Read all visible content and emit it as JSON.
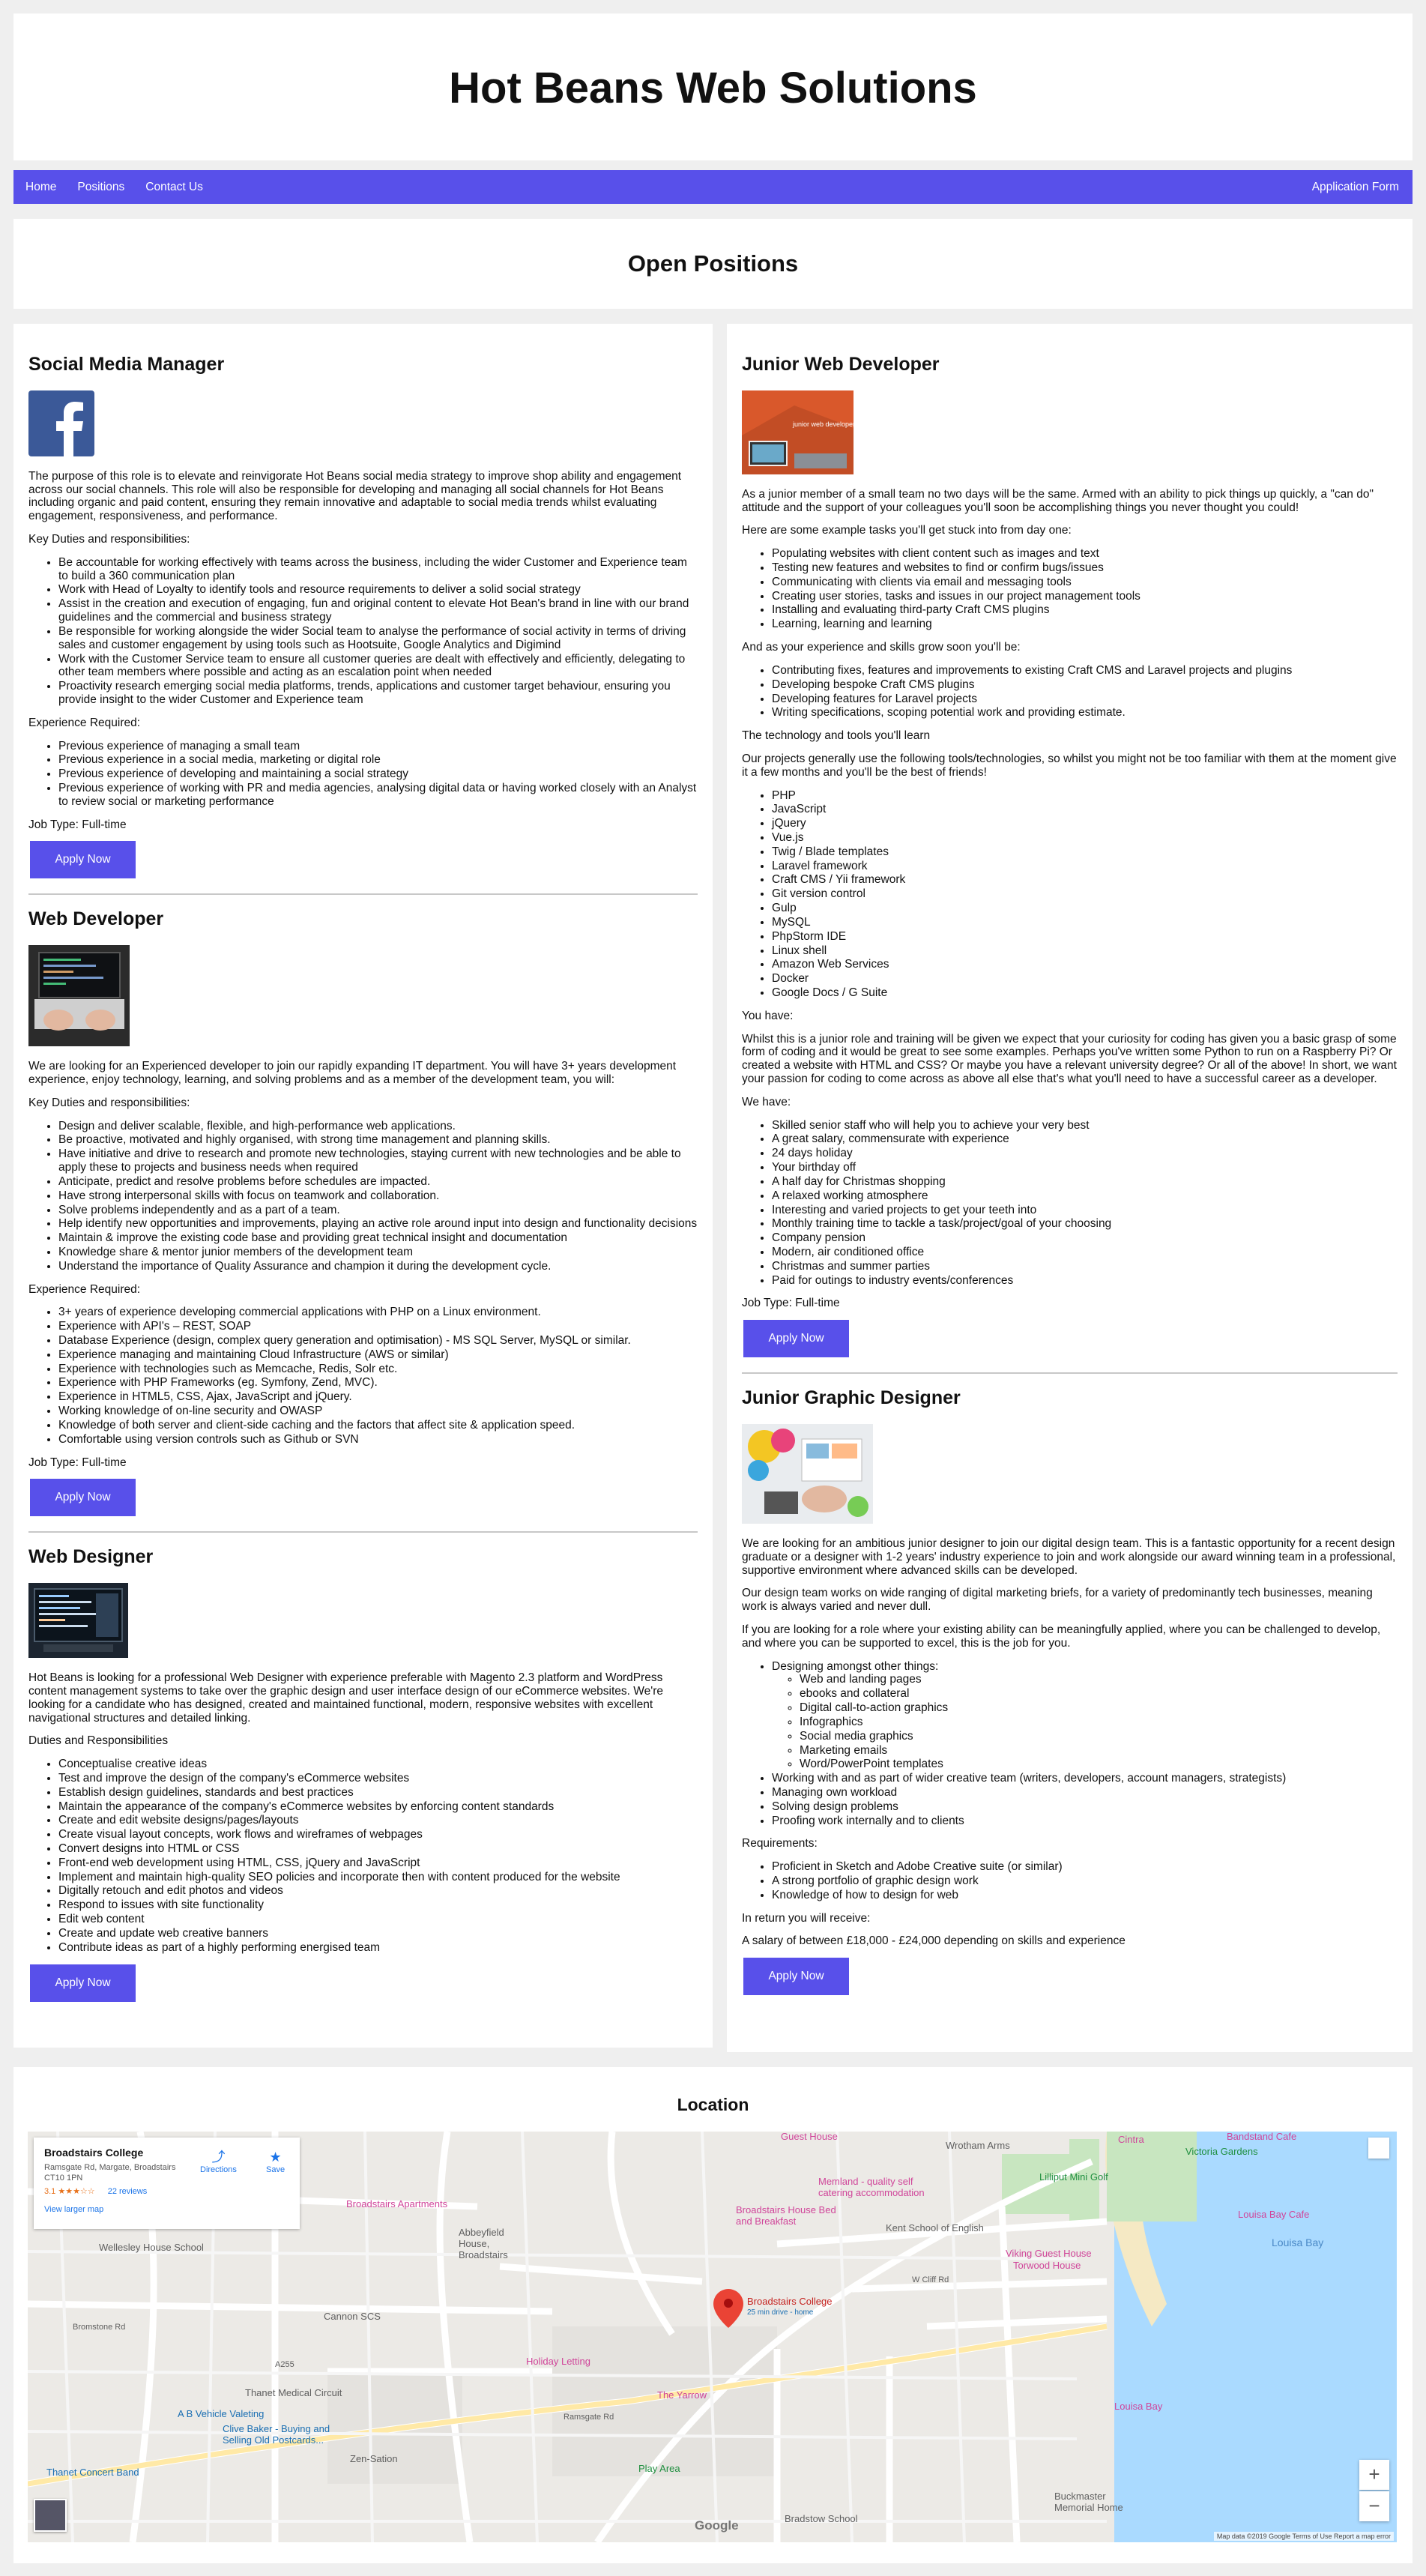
{
  "site": {
    "title": "Hot Beans Web Solutions"
  },
  "nav": {
    "home": "Home",
    "positions": "Positions",
    "contact": "Contact Us",
    "application": "Application Form"
  },
  "page": {
    "heading": "Open Positions"
  },
  "colors": {
    "accent": "#5850ea",
    "background": "#efefef"
  },
  "jobs": {
    "social": {
      "title": "Social Media Manager",
      "intro": "The purpose of this role is to elevate and reinvigorate Hot Beans social media strategy to improve shop ability and engagement across our social channels. This role will also be responsible for developing and managing all social channels for Hot Beans including organic and paid content, ensuring they remain innovative and adaptable to social media trends whilst evaluating engagement, responsiveness, and performance.",
      "duties_heading": "Key Duties and responsibilities:",
      "duties": [
        "Be accountable for working effectively with teams across the business, including the wider Customer and Experience team to build a 360 communication plan",
        "Work with Head of Loyalty to identify tools and resource requirements to deliver a solid social strategy",
        "Assist in the creation and execution of engaging, fun and original content to elevate Hot Bean's brand in line with our brand guidelines and the commercial and business strategy",
        "Be responsible for working alongside the wider Social team to analyse the performance of social activity in terms of driving sales and customer engagement by using tools such as Hootsuite, Google Analytics and Digimind",
        "Work with the Customer Service team to ensure all customer queries are dealt with effectively and efficiently, delegating to other team members where possible and acting as an escalation point when needed",
        "Proactivity research emerging social media platforms, trends, applications and customer target behaviour, ensuring you provide insight to the wider Customer and Experience team"
      ],
      "exp_heading": "Experience Required:",
      "experience": [
        "Previous experience of managing a small team",
        "Previous experience in a social media, marketing or digital role",
        "Previous experience of developing and maintaining a social strategy",
        "Previous experience of working with PR and media agencies, analysing digital data or having worked closely with an Analyst to review social or marketing performance"
      ],
      "job_type": "Job Type: Full-time",
      "apply": "Apply Now"
    },
    "webdev": {
      "title": "Web Developer",
      "intro": "We are looking for an Experienced developer to join our rapidly expanding IT department. You will have 3+ years development experience, enjoy technology, learning, and solving problems and as a member of the development team, you will:",
      "duties_heading": "Key Duties and responsibilities:",
      "duties": [
        "Design and deliver scalable, flexible, and high-performance web applications.",
        "Be proactive, motivated and highly organised, with strong time management and planning skills.",
        "Have initiative and drive to research and promote new technologies, staying current with new technologies and be able to apply these to projects and business needs when required",
        "Anticipate, predict and resolve problems before schedules are impacted.",
        "Have strong interpersonal skills with focus on teamwork and collaboration.",
        "Solve problems independently and as a part of a team.",
        "Help identify new opportunities and improvements, playing an active role around input into design and functionality decisions",
        "Maintain & improve the existing code base and providing great technical insight and documentation",
        "Knowledge share & mentor junior members of the development team",
        "Understand the importance of Quality Assurance and champion it during the development cycle."
      ],
      "exp_heading": "Experience Required:",
      "experience": [
        "3+ years of experience developing commercial applications with PHP on a Linux environment.",
        "Experience with API's – REST, SOAP",
        "Database Experience (design, complex query generation and optimisation) - MS SQL Server, MySQL or similar.",
        "Experience managing and maintaining Cloud Infrastructure (AWS or similar)",
        "Experience with technologies such as Memcache, Redis, Solr etc.",
        "Experience with PHP Frameworks (eg. Symfony, Zend, MVC).",
        "Experience in HTML5, CSS, Ajax, JavaScript and jQuery.",
        "Working knowledge of on-line security and OWASP",
        "Knowledge of both server and client-side caching and the factors that affect site & application speed.",
        "Comfortable using version controls such as Github or SVN"
      ],
      "job_type": "Job Type: Full-time",
      "apply": "Apply Now"
    },
    "webdesign": {
      "title": "Web Designer",
      "intro": "Hot Beans is looking for a professional Web Designer with experience preferable with Magento 2.3 platform and WordPress content management systems to take over the graphic design and user interface design of our eCommerce websites. We're looking for a candidate who has designed, created and maintained functional, modern, responsive websites with excellent navigational structures and detailed linking.",
      "duties_heading": "Duties and Responsibilities",
      "duties": [
        "Conceptualise creative ideas",
        "Test and improve the design of the company's eCommerce websites",
        "Establish design guidelines, standards and best practices",
        "Maintain the appearance of the company's eCommerce websites by enforcing content standards",
        "Create and edit website designs/pages/layouts",
        "Create visual layout concepts, work flows and wireframes of webpages",
        "Convert designs into HTML or CSS",
        "Front-end web development using HTML, CSS, jQuery and JavaScript",
        "Implement and maintain high-quality SEO policies and incorporate then with content produced for the website",
        "Digitally retouch and edit photos and videos",
        "Respond to issues with site functionality",
        "Edit web content",
        "Create and update web creative banners",
        "Contribute ideas as part of a highly performing energised team"
      ],
      "apply": "Apply Now"
    },
    "junior": {
      "title": "Junior Web Developer",
      "thumb_text": "junior web developer",
      "intro": "As a junior member of a small team no two days will be the same. Armed with an ability to pick things up quickly, a \"can do\" attitude and the support of your colleagues you'll soon be accomplishing things you never thought you could!",
      "tasks_heading": "Here are some example tasks you'll get stuck into from day one:",
      "tasks": [
        "Populating websites with client content such as images and text",
        "Testing new features and websites to find or confirm bugs/issues",
        "Communicating with clients via email and messaging tools",
        "Creating user stories, tasks and issues in our project management tools",
        "Installing and evaluating third-party Craft CMS plugins",
        "Learning, learning and learning"
      ],
      "grow_heading": "And as your experience and skills grow soon you'll be:",
      "grow": [
        "Contributing fixes, features and improvements to existing Craft CMS and Laravel projects and plugins",
        "Developing bespoke Craft CMS plugins",
        "Developing features for Laravel projects",
        "Writing specifications, scoping potential work and providing estimate."
      ],
      "tools_heading": "The technology and tools you'll learn",
      "tools_intro": "Our projects generally use the following tools/technologies, so whilst you might not be too familiar with them at the moment give it a few months and you'll be the best of friends!",
      "tools": [
        "PHP",
        "JavaScript",
        "jQuery",
        "Vue.js",
        "Twig / Blade templates",
        "Laravel framework",
        "Craft CMS / Yii framework",
        "Git version control",
        "Gulp",
        "MySQL",
        "PhpStorm IDE",
        "Linux shell",
        "Amazon Web Services",
        "Docker",
        "Google Docs / G Suite"
      ],
      "you_heading": "You have:",
      "you_text": "Whilst this is a junior role and training will be given we expect that your curiosity for coding has given you a basic grasp of some form of coding and it would be great to see some examples. Perhaps you've written some Python to run on a Raspberry Pi? Or created a website with HTML and CSS? Or maybe you have a relevant university degree? Or all of the above! In short, we want your passion for coding to come across as above all else that's what you'll need to have a successful career as a developer.",
      "we_heading": "We have:",
      "we": [
        "Skilled senior staff who will help you to achieve your very best",
        "A great salary, commensurate with experience",
        "24 days holiday",
        "Your birthday off",
        "A half day for Christmas shopping",
        "A relaxed working atmosphere",
        "Interesting and varied projects to get your teeth into",
        "Monthly training time to tackle a task/project/goal of your choosing",
        "Company pension",
        "Modern, air conditioned office",
        "Christmas and summer parties",
        "Paid for outings to industry events/conferences"
      ],
      "job_type": "Job Type: Full-time",
      "apply": "Apply Now"
    },
    "graphic": {
      "title": "Junior Graphic Designer",
      "p1": "We are looking for an ambitious junior designer to join our digital design team. This is a fantastic opportunity for a recent design graduate or a designer with 1-2 years' industry experience to join and work alongside our award winning team in a professional, supportive environment where advanced skills can be developed.",
      "p2": "Our design team works on wide ranging of digital marketing briefs, for a variety of predominantly tech businesses, meaning work is always varied and never dull.",
      "p3": "If you are looking for a role where your existing ability can be meaningfully applied, where you can be challenged to develop, and where you can be supported to excel, this is the job for you.",
      "designing": "Designing amongst other things:",
      "designing_items": [
        "Web and landing pages",
        "ebooks and collateral",
        "Digital call-to-action graphics",
        "Infographics",
        "Social media graphics",
        "Marketing emails",
        "Word/PowerPoint templates"
      ],
      "other": [
        "Working with and as part of wider creative team (writers, developers, account managers, strategists)",
        "Managing own workload",
        "Solving design problems",
        "Proofing work internally and to clients"
      ],
      "req_heading": "Requirements:",
      "requirements": [
        "Proficient in Sketch and Adobe Creative suite (or similar)",
        "A strong portfolio of graphic design work",
        "Knowledge of how to design for web"
      ],
      "return_heading": "In return you will receive:",
      "salary": "A salary of between £18,000 - £24,000 depending on skills and experience",
      "apply": "Apply Now"
    }
  },
  "location": {
    "heading": "Location",
    "card": {
      "name": "Broadstairs College",
      "address": "Ramsgate Rd, Margate, Broadstairs CT10 1PN",
      "rating": "3.1 ★★★☆☆",
      "reviews": "22 reviews",
      "larger": "View larger map",
      "directions": "Directions",
      "save": "Save"
    },
    "labels": {
      "guest": "Guest House",
      "wrotham": "Wrotham Arms",
      "cintra": "Cintra",
      "bandstand": "Bandstand Cafe",
      "victoria": "Victoria Gardens",
      "lilliput": "Lilliput Mini Golf",
      "memland": "Memland - quality self catering accommodation",
      "bs_house": "Broadstairs House Bed and Breakfast",
      "kent": "Kent School of English",
      "viking": "Viking Guest House",
      "torwood": "Torwood House",
      "louisa_cafe": "Louisa Bay Cafe",
      "louisa_bay": "Louisa Bay",
      "bs_apartments": "Broadstairs Apartments",
      "abbeyfield": "Abbeyfield House, Broadstairs",
      "wellesley": "Wellesley House School",
      "cannon": "Cannon SCS",
      "holiday": "Holiday Letting",
      "yarrow": "The Yarrow",
      "college": "Broadstairs College",
      "drive": "25 min drive - home",
      "thanet_circuit": "Thanet Medical Circuit",
      "louisa_bay2": "Louisa Bay",
      "ab_vehicle": "A B Vehicle Valeting",
      "clive": "Clive Baker - Buying and Selling Old Postcards...",
      "zen": "Zen-Sation",
      "thanet_band": "Thanet Concert Band",
      "play": "Play Area",
      "buckmaster": "Buckmaster Memorial Home",
      "bradstow": "Bradstow School",
      "a255": "A255",
      "ramsgate": "Ramsgate Rd",
      "w_cliff": "W Cliff Rd",
      "bromstone": "Bromstone Rd",
      "google": "Google",
      "footer": "Map data ©2019 Google   Terms of Use   Report a map error"
    }
  }
}
